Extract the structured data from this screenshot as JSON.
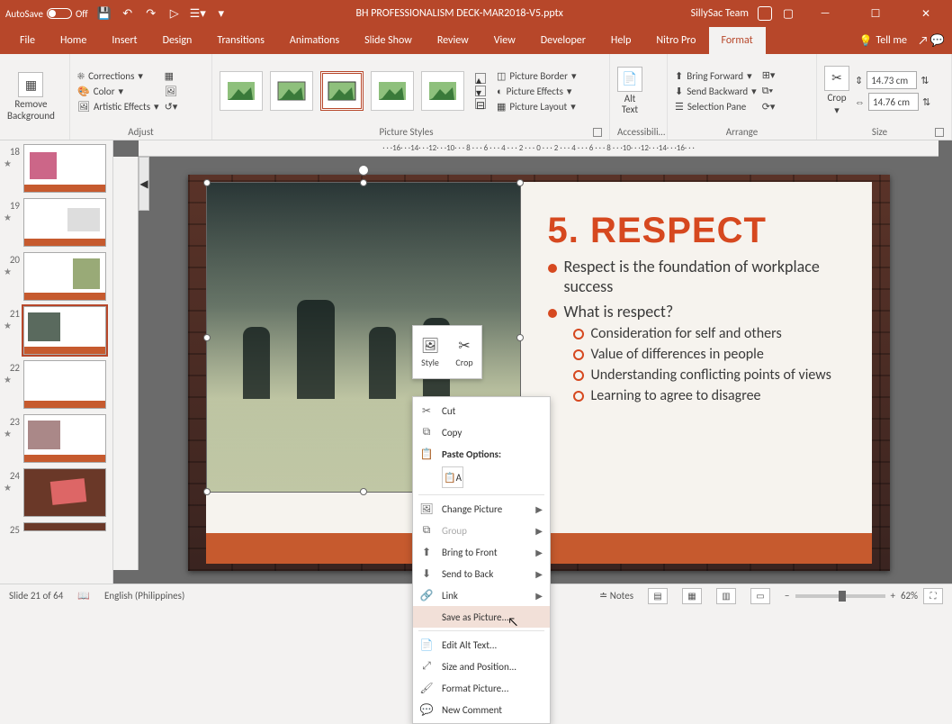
{
  "titlebar": {
    "autosave_label": "AutoSave",
    "autosave_state": "Off",
    "filename": "BH PROFESSIONALISM DECK-MAR2018-V5.pptx",
    "account": "SillySac Team"
  },
  "tabs": [
    "File",
    "Home",
    "Insert",
    "Design",
    "Transitions",
    "Animations",
    "Slide Show",
    "Review",
    "View",
    "Developer",
    "Help",
    "Nitro Pro",
    "Format"
  ],
  "active_tab": "Format",
  "tellme": "Tell me",
  "ribbon": {
    "remove_bg": "Remove\nBackground",
    "corrections": "Corrections",
    "color": "Color",
    "artistic": "Artistic Effects",
    "group_adjust": "Adjust",
    "group_styles": "Picture Styles",
    "border": "Picture Border",
    "effects": "Picture Effects",
    "layout": "Picture Layout",
    "alt_text": "Alt\nText",
    "group_access": "Accessibili…",
    "bring_fwd": "Bring Forward",
    "send_back": "Send Backward",
    "sel_pane": "Selection Pane",
    "group_arrange": "Arrange",
    "crop": "Crop",
    "height_val": "14.73 cm",
    "width_val": "14.76 cm",
    "group_size": "Size"
  },
  "ruler_text": "· · ·16· · ·14· · ·12· · ·10· · · 8 · · · 6 · · · 4 · · · 2 · · · 0 · · · 2 · · · 4 · · · 6 · · · 8 · · ·10· · ·12· · ·14· · ·16· · ·",
  "thumbnails": [
    {
      "n": "18"
    },
    {
      "n": "19"
    },
    {
      "n": "20"
    },
    {
      "n": "21",
      "sel": true
    },
    {
      "n": "22"
    },
    {
      "n": "23"
    },
    {
      "n": "24"
    },
    {
      "n": "25"
    }
  ],
  "slide": {
    "title": "5. RESPECT",
    "b1a": "Respect is the foundation of workplace success",
    "b1b": "What is respect?",
    "b2a": "Consideration for self and others",
    "b2b": "Value of differences in people",
    "b2c": "Understanding conflicting points of views",
    "b2d": "Learning to agree to disagree"
  },
  "minitool": {
    "style": "Style",
    "crop": "Crop"
  },
  "context_menu": {
    "cut": "Cut",
    "copy": "Copy",
    "paste_label": "Paste Options:",
    "change_pic": "Change Picture",
    "group": "Group",
    "bring_front": "Bring to Front",
    "send_back": "Send to Back",
    "link": "Link",
    "save_pic": "Save as Picture...",
    "edit_alt": "Edit Alt Text...",
    "size_pos": "Size and Position...",
    "fmt_pic": "Format Picture...",
    "new_comment": "New Comment"
  },
  "status": {
    "slide": "Slide 21 of 64",
    "lang": "English (Philippines)",
    "notes": "Notes",
    "zoom": "62%"
  }
}
